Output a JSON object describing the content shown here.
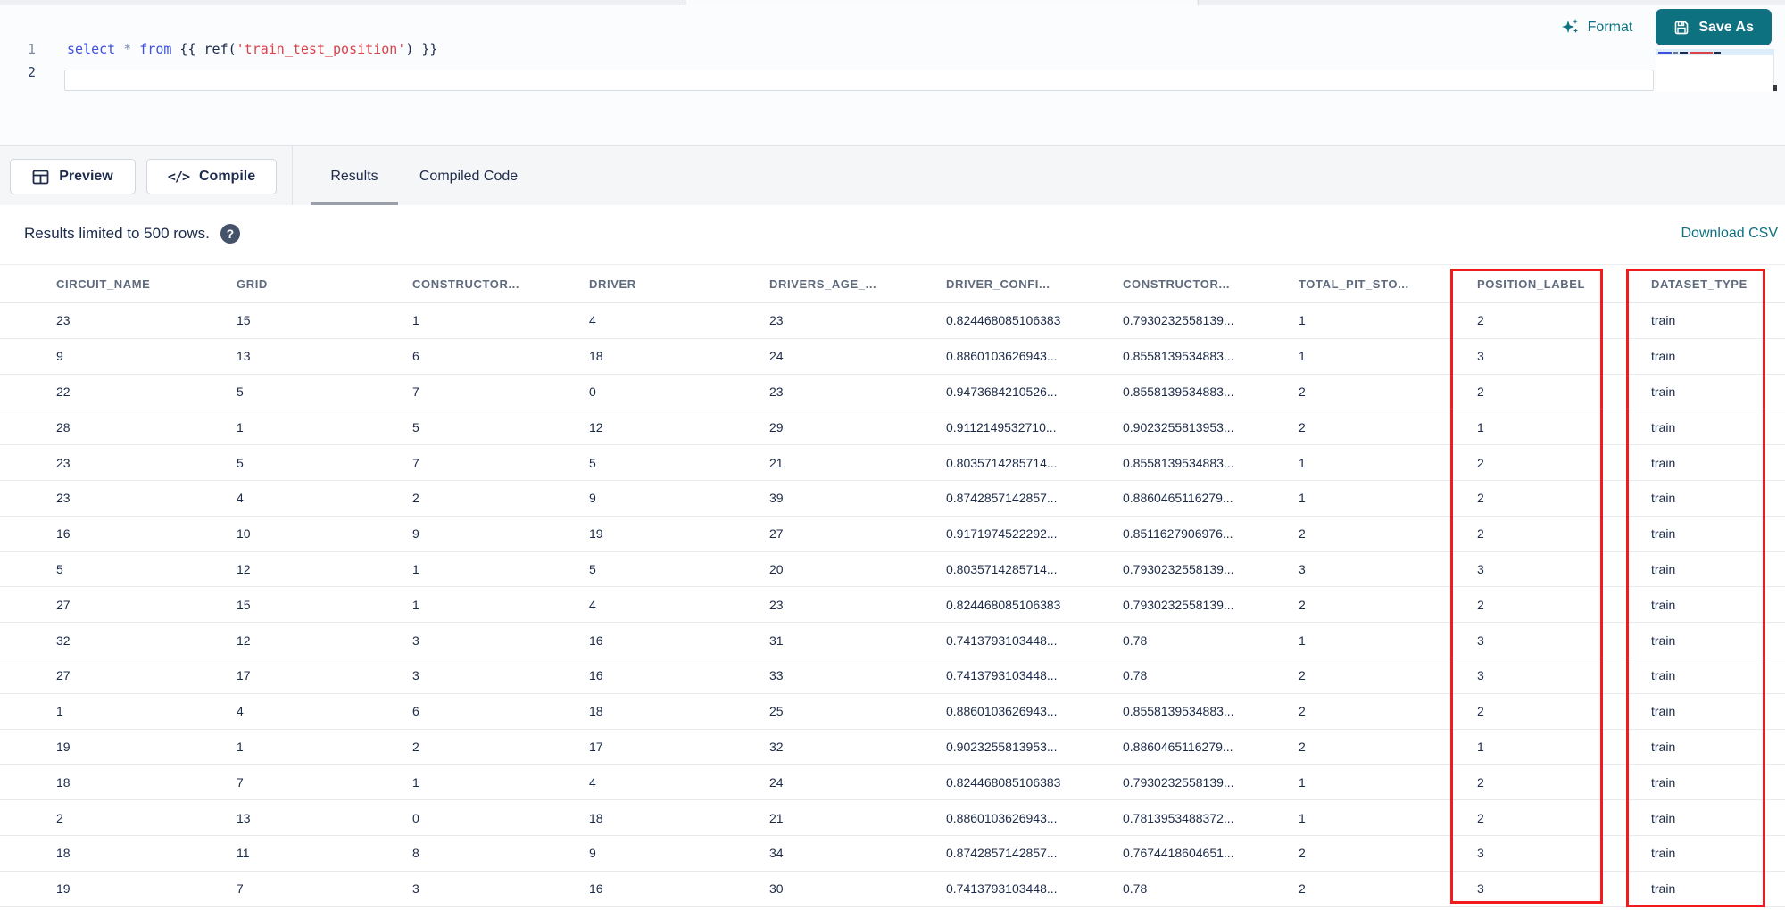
{
  "colors": {
    "accent": "#0E7180",
    "annotation": "#F21B1B",
    "code-keyword": "#3D50E0",
    "code-operator": "#7D8CB0",
    "code-jinja": "#1B2A4E",
    "code-string": "#D8434A",
    "text-dark": "#1B2B4D",
    "text-header": "#5F6B7D"
  },
  "editor": {
    "lines": [
      {
        "number": "1",
        "tokens": [
          {
            "t": "select",
            "c": "keyword"
          },
          {
            "t": " ",
            "c": "plain"
          },
          {
            "t": "*",
            "c": "operator"
          },
          {
            "t": " ",
            "c": "plain"
          },
          {
            "t": "from",
            "c": "keyword"
          },
          {
            "t": " {{ ref(",
            "c": "jinja"
          },
          {
            "t": "'train_test_position'",
            "c": "string"
          },
          {
            "t": ") }}",
            "c": "jinja"
          }
        ]
      },
      {
        "number": "2",
        "tokens": []
      }
    ]
  },
  "actions": {
    "format_label": "Format",
    "save_as_label": "Save As"
  },
  "toolbar": {
    "preview_label": "Preview",
    "compile_label": "Compile",
    "compile_glyph": "</>",
    "tabs": [
      {
        "label": "Results",
        "active": true
      },
      {
        "label": "Compiled Code",
        "active": false
      }
    ]
  },
  "results_bar": {
    "message": "Results limited to 500 rows.",
    "help_glyph": "?",
    "download_label": "Download CSV"
  },
  "table": {
    "columns": [
      "CIRCUIT_NAME",
      "GRID",
      "CONSTRUCTOR...",
      "DRIVER",
      "DRIVERS_AGE_...",
      "DRIVER_CONFI...",
      "CONSTRUCTOR...",
      "TOTAL_PIT_STO...",
      "POSITION_LABEL",
      "DATASET_TYPE"
    ],
    "rows": [
      [
        "23",
        "15",
        "1",
        "4",
        "23",
        "0.824468085106383",
        "0.7930232558139...",
        "1",
        "2",
        "train"
      ],
      [
        "9",
        "13",
        "6",
        "18",
        "24",
        "0.8860103626943...",
        "0.8558139534883...",
        "1",
        "3",
        "train"
      ],
      [
        "22",
        "5",
        "7",
        "0",
        "23",
        "0.9473684210526...",
        "0.8558139534883...",
        "2",
        "2",
        "train"
      ],
      [
        "28",
        "1",
        "5",
        "12",
        "29",
        "0.9112149532710...",
        "0.9023255813953...",
        "2",
        "1",
        "train"
      ],
      [
        "23",
        "5",
        "7",
        "5",
        "21",
        "0.8035714285714...",
        "0.8558139534883...",
        "1",
        "2",
        "train"
      ],
      [
        "23",
        "4",
        "2",
        "9",
        "39",
        "0.8742857142857...",
        "0.8860465116279...",
        "1",
        "2",
        "train"
      ],
      [
        "16",
        "10",
        "9",
        "19",
        "27",
        "0.9171974522292...",
        "0.8511627906976...",
        "2",
        "2",
        "train"
      ],
      [
        "5",
        "12",
        "1",
        "5",
        "20",
        "0.8035714285714...",
        "0.7930232558139...",
        "3",
        "3",
        "train"
      ],
      [
        "27",
        "15",
        "1",
        "4",
        "23",
        "0.824468085106383",
        "0.7930232558139...",
        "2",
        "2",
        "train"
      ],
      [
        "32",
        "12",
        "3",
        "16",
        "31",
        "0.7413793103448...",
        "0.78",
        "1",
        "3",
        "train"
      ],
      [
        "27",
        "17",
        "3",
        "16",
        "33",
        "0.7413793103448...",
        "0.78",
        "2",
        "3",
        "train"
      ],
      [
        "1",
        "4",
        "6",
        "18",
        "25",
        "0.8860103626943...",
        "0.8558139534883...",
        "2",
        "2",
        "train"
      ],
      [
        "19",
        "1",
        "2",
        "17",
        "32",
        "0.9023255813953...",
        "0.8860465116279...",
        "2",
        "1",
        "train"
      ],
      [
        "18",
        "7",
        "1",
        "4",
        "24",
        "0.824468085106383",
        "0.7930232558139...",
        "1",
        "2",
        "train"
      ],
      [
        "2",
        "13",
        "0",
        "18",
        "21",
        "0.8860103626943...",
        "0.7813953488372...",
        "1",
        "2",
        "train"
      ],
      [
        "18",
        "11",
        "8",
        "9",
        "34",
        "0.8742857142857...",
        "0.7674418604651...",
        "2",
        "3",
        "train"
      ],
      [
        "19",
        "7",
        "3",
        "16",
        "30",
        "0.7413793103448...",
        "0.78",
        "2",
        "3",
        "train"
      ]
    ]
  },
  "annotations": {
    "highlighted_columns": [
      "POSITION_LABEL",
      "DATASET_TYPE"
    ]
  }
}
